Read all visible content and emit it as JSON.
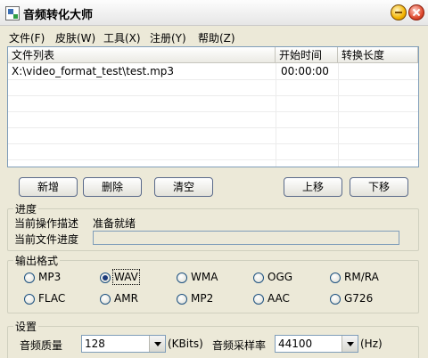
{
  "window": {
    "title": "音频转化大师"
  },
  "menu": [
    {
      "label": "文件(F)"
    },
    {
      "label": "皮肤(W)"
    },
    {
      "label": "工具(X)"
    },
    {
      "label": "注册(Y)"
    },
    {
      "label": "帮助(Z)"
    }
  ],
  "filelist": {
    "columns": [
      "文件列表",
      "开始时间",
      "转换长度"
    ],
    "rows": [
      {
        "file": "X:\\video_format_test\\test.mp3",
        "start": "00:00:00",
        "length": ""
      }
    ]
  },
  "buttons": {
    "add": "新增",
    "delete": "删除",
    "clear": "清空",
    "move_up": "上移",
    "move_down": "下移"
  },
  "progress": {
    "group_title": "进度",
    "op_label": "当前操作描述",
    "op_value": "准备就绪",
    "file_label": "当前文件进度",
    "file_progress": 0
  },
  "format": {
    "group_title": "输出格式",
    "options": [
      "MP3",
      "WAV",
      "WMA",
      "OGG",
      "RM/RA",
      "FLAC",
      "AMR",
      "MP2",
      "AAC",
      "G726"
    ],
    "selected": "WAV"
  },
  "settings": {
    "group_title": "设置",
    "quality_label": "音频质量",
    "quality_value": "128",
    "quality_unit": "(KBits)",
    "rate_label": "音频采样率",
    "rate_value": "44100",
    "rate_unit": "(Hz)"
  },
  "colors": {
    "accent": "#1a3a7a",
    "border": "#7f9db9",
    "background": "#ece9d8"
  }
}
